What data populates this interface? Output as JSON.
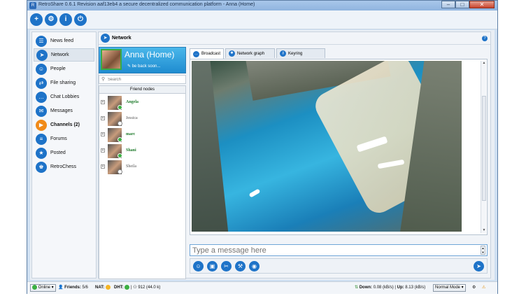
{
  "window": {
    "title": "RetroShare 0.6.1 Revision aaf13eb4 a secure decentralized communication platform - Anna (Home)",
    "minimize": "–",
    "maximize": "□",
    "close": "✕"
  },
  "toolbar": {
    "buttons": [
      {
        "icon": "add-friend-icon",
        "glyph": "+"
      },
      {
        "icon": "options-gear-icon",
        "glyph": "⚙"
      },
      {
        "icon": "about-info-icon",
        "glyph": "i"
      },
      {
        "icon": "power-quit-icon",
        "glyph": "⏻"
      }
    ]
  },
  "sidebar": {
    "items": [
      {
        "label": "News feed",
        "icon": "news-feed-icon",
        "glyph": "☰"
      },
      {
        "label": "Network",
        "icon": "network-icon",
        "glyph": "➤"
      },
      {
        "label": "People",
        "icon": "people-icon",
        "glyph": "☺"
      },
      {
        "label": "File sharing",
        "icon": "file-sharing-icon",
        "glyph": "⇄"
      },
      {
        "label": "Chat Lobbies",
        "icon": "chat-lobbies-icon",
        "glyph": "…"
      },
      {
        "label": "Messages",
        "icon": "messages-icon",
        "glyph": "✉"
      },
      {
        "label": "Channels (2)",
        "icon": "channels-icon",
        "glyph": "▶"
      },
      {
        "label": "Forums",
        "icon": "forums-icon",
        "glyph": "≡"
      },
      {
        "label": "Posted",
        "icon": "posted-icon",
        "glyph": "★"
      },
      {
        "label": "RetroChess",
        "icon": "retrochess-icon",
        "glyph": "♚"
      }
    ]
  },
  "network": {
    "title": "Network",
    "help": "?",
    "profile": {
      "name": "Anna (Home)",
      "status": "be back soon..."
    },
    "search": {
      "placeholder": "Search",
      "value": ""
    },
    "friend_nodes_header": "Friend nodes",
    "friends": [
      {
        "name": "Angela",
        "online": true
      },
      {
        "name": "Jessica",
        "online": false
      },
      {
        "name": "marc",
        "online": true
      },
      {
        "name": "Shani",
        "online": true
      },
      {
        "name": "Sheila",
        "online": false
      }
    ],
    "tabs": [
      {
        "label": "Broadcast",
        "icon": "broadcast-icon",
        "glyph": "…"
      },
      {
        "label": "Network graph",
        "icon": "network-graph-icon",
        "glyph": "✱"
      },
      {
        "label": "Keyring",
        "icon": "keyring-icon",
        "glyph": "⚷"
      }
    ],
    "message_input": {
      "placeholder": "Type a message here",
      "value": ""
    },
    "chat_buttons": [
      {
        "icon": "emoticon-icon",
        "glyph": "☺"
      },
      {
        "icon": "image-icon",
        "glyph": "▣"
      },
      {
        "icon": "attach-file-icon",
        "glyph": "✂"
      },
      {
        "icon": "tools-icon",
        "glyph": "⚒"
      },
      {
        "icon": "font-icon",
        "glyph": "◉"
      }
    ],
    "send_glyph": "➤"
  },
  "statusbar": {
    "status_combo": "Online",
    "friends_label": "Friends:",
    "friends_value": "5/6",
    "nat_label": "NAT:",
    "dht_label": "DHT:",
    "dht_value": "912",
    "dht_extra": "(44.0 k)",
    "down_label": "Down:",
    "down_value": "0.08 (kB/s)",
    "up_label": "Up:",
    "up_value": "8.13 (kB/s)",
    "mode_combo": "Normal Mode"
  }
}
